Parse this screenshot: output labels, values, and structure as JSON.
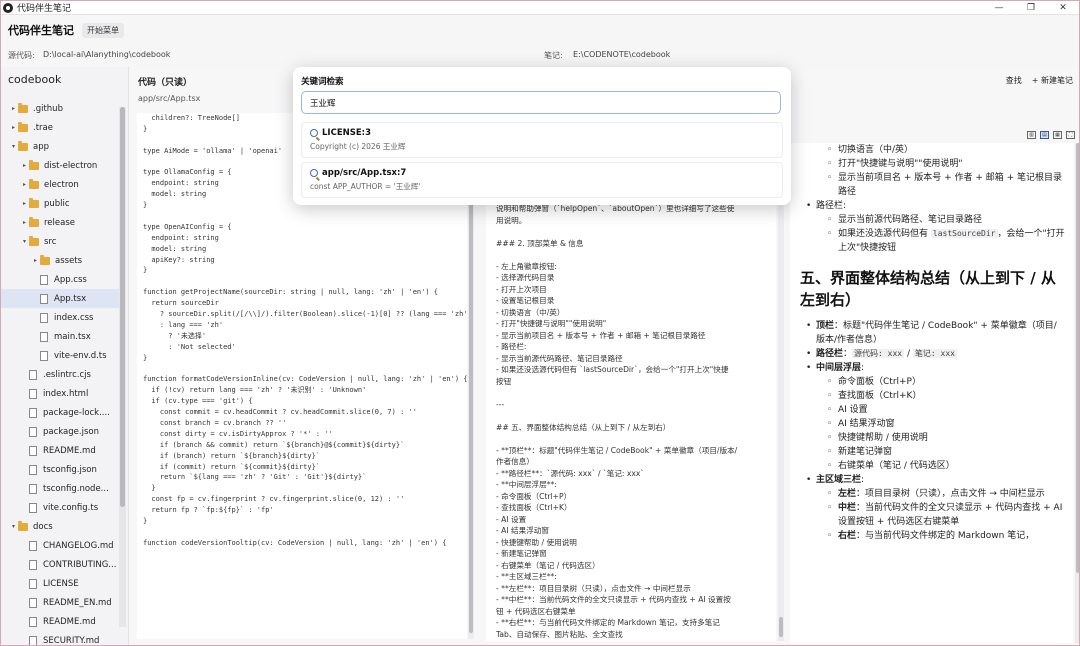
{
  "window": {
    "title": "代码伴生笔记",
    "controls": [
      "—",
      "❐",
      "✕"
    ]
  },
  "toolbar": {
    "brand": "代码伴生笔记",
    "menu_label": "开始菜单"
  },
  "paths": {
    "source_label": "源代码:",
    "source_value": "D:\\local-ai\\Alanything\\codebook",
    "note_label": "笔记:",
    "note_value": "E:\\CODENOTE\\codebook"
  },
  "sidebar": {
    "root": "codebook",
    "items": [
      {
        "label": ".github",
        "type": "folder",
        "depth": 0,
        "caret": "▸"
      },
      {
        "label": ".trae",
        "type": "folder",
        "depth": 0,
        "caret": "▸"
      },
      {
        "label": "app",
        "type": "folder",
        "depth": 0,
        "caret": "▾"
      },
      {
        "label": "dist-electron",
        "type": "folder",
        "depth": 1,
        "caret": "▸"
      },
      {
        "label": "electron",
        "type": "folder",
        "depth": 1,
        "caret": "▸"
      },
      {
        "label": "public",
        "type": "folder",
        "depth": 1,
        "caret": "▸"
      },
      {
        "label": "release",
        "type": "folder",
        "depth": 1,
        "caret": "▸"
      },
      {
        "label": "src",
        "type": "folder",
        "depth": 1,
        "caret": "▾"
      },
      {
        "label": "assets",
        "type": "folder",
        "depth": 2,
        "caret": "▸"
      },
      {
        "label": "App.css",
        "type": "file",
        "depth": 2
      },
      {
        "label": "App.tsx",
        "type": "file",
        "depth": 2,
        "selected": true
      },
      {
        "label": "index.css",
        "type": "file",
        "depth": 2
      },
      {
        "label": "main.tsx",
        "type": "file",
        "depth": 2
      },
      {
        "label": "vite-env.d.ts",
        "type": "file",
        "depth": 2
      },
      {
        "label": ".eslintrc.cjs",
        "type": "file",
        "depth": 1
      },
      {
        "label": "index.html",
        "type": "file",
        "depth": 1
      },
      {
        "label": "package-lock....",
        "type": "file",
        "depth": 1
      },
      {
        "label": "package.json",
        "type": "file",
        "depth": 1
      },
      {
        "label": "README.md",
        "type": "file",
        "depth": 1
      },
      {
        "label": "tsconfig.json",
        "type": "file",
        "depth": 1
      },
      {
        "label": "tsconfig.node...",
        "type": "file",
        "depth": 1
      },
      {
        "label": "vite.config.ts",
        "type": "file",
        "depth": 1
      },
      {
        "label": "docs",
        "type": "folder",
        "depth": 0,
        "caret": "▾"
      },
      {
        "label": "CHANGELOG.md",
        "type": "file",
        "depth": 1
      },
      {
        "label": "CONTRIBUTING...",
        "type": "file",
        "depth": 1
      },
      {
        "label": "LICENSE",
        "type": "file",
        "depth": 1
      },
      {
        "label": "README_EN.md",
        "type": "file",
        "depth": 1
      },
      {
        "label": "README.md",
        "type": "file",
        "depth": 1
      },
      {
        "label": "SECURITY.md",
        "type": "file",
        "depth": 1
      }
    ]
  },
  "code_panel": {
    "title": "代码（只读）",
    "file_path": "app/src/App.tsx",
    "lines": [
      "  children?: TreeNode[]",
      "}",
      "",
      "type AiMode = 'ollama' | 'openai'",
      "",
      "type OllamaConfig = {",
      "  endpoint: string",
      "  model: string",
      "}",
      "",
      "type OpenAIConfig = {",
      "  endpoint: string",
      "  model: string",
      "  apiKey?: string",
      "}",
      "",
      "function getProjectName(sourceDir: string | null, lang: 'zh' | 'en') {",
      "  return sourceDir",
      "    ? sourceDir.split(/[/\\\\]/).filter(Boolean).slice(-1)[0] ?? (lang === 'zh'",
      "    : lang === 'zh'",
      "      ? '未选择'",
      "      : 'Not selected'",
      "}",
      "",
      "function formatCodeVersionInline(cv: CodeVersion | null, lang: 'zh' | 'en') {",
      "  if (!cv) return lang === 'zh' ? '未识别' : 'Unknown'",
      "  if (cv.type === 'git') {",
      "    const commit = cv.headCommit ? cv.headCommit.slice(0, 7) : ''",
      "    const branch = cv.branch ?? ''",
      "    const dirty = cv.isDirtyApprox ? '*' : ''",
      "    if (branch && commit) return `${branch}@${commit}${dirty}`",
      "    if (branch) return `${branch}${dirty}`",
      "    if (commit) return `${commit}${dirty}`",
      "    return `${lang === 'zh' ? 'Git' : 'Git'}${dirty}`",
      "  }",
      "  const fp = cv.fingerprint ? cv.fingerprint.slice(0, 12) : ''",
      "  return fp ? `fp:${fp}` : 'fp'",
      "}",
      "",
      "function codeVersionTooltip(cv: CodeVersion | null, lang: 'zh' | 'en') {"
    ]
  },
  "md_panel": {
    "lines": [
      "说明和帮助弹窗（`helpOpen`、`aboutOpen`）里也详细写了这些使",
      "用说明。",
      "",
      "### 2. 顶部菜单 & 信息",
      "",
      "- 左上角徽章按钮:",
      "  - 选择源代码目录",
      "  - 打开上次项目",
      "  - 设置笔记根目录",
      "  - 切换语言（中/英）",
      "  - 打开\"快捷键与说明\"\"使用说明\"",
      "  - 显示当前项目名 + 版本号 + 作者 + 邮箱 + 笔记根目录路径",
      "- 路径栏:",
      "  - 显示当前源代码路径、笔记目录路径",
      "  - 如果还没选源代码但有 `lastSourceDir`，会给一个\"打开上次\"快捷",
      "按钮",
      "",
      "---",
      "",
      "## 五、界面整体结构总结（从上到下 / 从左到右）",
      "",
      "- **顶栏**：标题\"代码伴生笔记 / CodeBook\" + 菜单徽章（项目/版本/",
      "作者信息）",
      "- **路径栏**：`源代码: xxx` / `笔记: xxx`",
      "- **中间层浮层**:",
      "  - 命令面板（Ctrl+P）",
      "  - 查找面板（Ctrl+K）",
      "  - AI 设置",
      "  - AI 结果浮动窗",
      "  - 快捷键帮助 / 使用说明",
      "  - 新建笔记弹窗",
      "  - 右键菜单（笔记 / 代码选区）",
      "- **主区域三栏**:",
      "  - **左栏**：项目目录树（只读），点击文件 → 中间栏显示",
      "  - **中栏**：当前代码文件的全文只读显示 + 代码内查找 + AI 设置按",
      "钮 + 代码选区右键菜单",
      "  - **右栏**：与当前代码文件绑定的 Markdown 笔记，支持多笔记",
      "Tab、自动保存、图片粘贴、全文查找"
    ]
  },
  "preview_panel": {
    "find_label": "查找",
    "new_note_label": "+ 新建笔记",
    "view_icons": [
      "split-editor-icon",
      "split-both-icon",
      "split-preview-icon",
      "fullscreen-icon"
    ],
    "top_items": [
      {
        "level": 2,
        "text": "切换语言（中/英）"
      },
      {
        "level": 2,
        "text": "打开\"快捷键与说明\"\"使用说明\""
      },
      {
        "level": 2,
        "text": "显示当前项目名 + 版本号 + 作者 + 邮箱 + 笔记根目录路径"
      },
      {
        "level": 1,
        "text": "路径栏:"
      },
      {
        "level": 2,
        "text": "显示当前源代码路径、笔记目录路径"
      }
    ],
    "last_source_prefix": "如果还没选源代码但有 ",
    "last_source_code": "lastSourceDir",
    "last_source_suffix": "，会给一个\"打开上次\"快捷按钮",
    "heading": "五、界面整体结构总结（从上到下 / 从左到右）",
    "summary": {
      "top_bold": "顶栏",
      "top_text": "：标题\"代码伴生笔记 / CodeBook\" + 菜单徽章（项目/版本/作者信息）",
      "path_bold": "路径栏",
      "path_code1": "源代码: xxx",
      "path_sep": " / ",
      "path_code2": "笔记: xxx",
      "middle_bold": "中间层浮层",
      "middle_items": [
        "命令面板（Ctrl+P）",
        "查找面板（Ctrl+K）",
        "AI 设置",
        "AI 结果浮动窗",
        "快捷键帮助 / 使用说明",
        "新建笔记弹窗",
        "右键菜单（笔记 / 代码选区）"
      ],
      "main_bold": "主区域三栏",
      "left_bold": "左栏",
      "left_text": "：项目目录树（只读），点击文件 → 中间栏显示",
      "mid_bold": "中栏",
      "mid_text": "：当前代码文件的全文只读显示 + 代码内查找 + AI 设置按钮 + 代码选区右键菜单",
      "right_bold": "右栏",
      "right_text": "：与当前代码文件绑定的 Markdown 笔记，"
    }
  },
  "search_modal": {
    "title": "关键词检索",
    "query": "王业辉",
    "results": [
      {
        "title": "LICENSE:3",
        "snippet": "Copyright (c) 2026 王业辉"
      },
      {
        "title": "app/src/App.tsx:7",
        "snippet": "const APP_AUTHOR = '王业辉'"
      }
    ]
  }
}
